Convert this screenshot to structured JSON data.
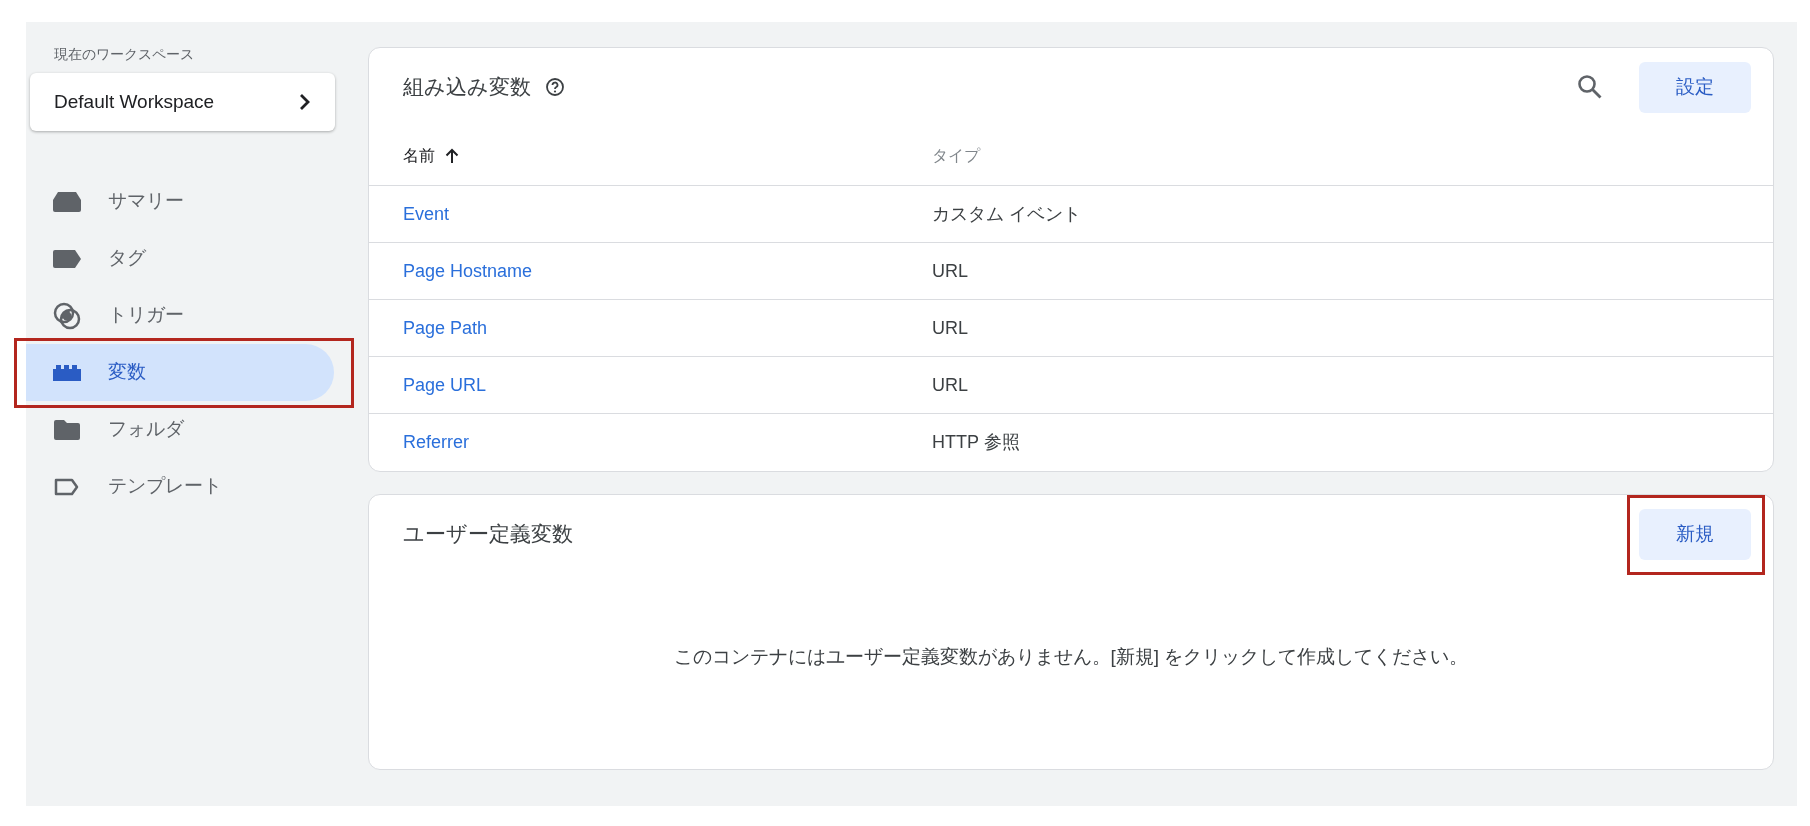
{
  "sidebar": {
    "workspace_label": "現在のワークスペース",
    "workspace": "Default Workspace",
    "items": [
      {
        "label": "サマリー",
        "selected": false
      },
      {
        "label": "タグ",
        "selected": false
      },
      {
        "label": "トリガー",
        "selected": false
      },
      {
        "label": "変数",
        "selected": true,
        "highlighted": true
      },
      {
        "label": "フォルダ",
        "selected": false
      },
      {
        "label": "テンプレート",
        "selected": false
      }
    ]
  },
  "builtin": {
    "title": "組み込み変数",
    "button": "設定",
    "columns": [
      {
        "label": "名前",
        "sorted": true
      },
      {
        "label": "タイプ",
        "sorted": false
      }
    ],
    "rows": [
      {
        "name": "Event",
        "type": "カスタム イベント"
      },
      {
        "name": "Page Hostname",
        "type": "URL"
      },
      {
        "name": "Page Path",
        "type": "URL"
      },
      {
        "name": "Page URL",
        "type": "URL"
      },
      {
        "name": "Referrer",
        "type": "HTTP 参照"
      }
    ]
  },
  "user_defined": {
    "title": "ユーザー定義変数",
    "button": "新規",
    "button_highlighted": true,
    "empty_message": "このコンテナにはユーザー定義変数がありません。[新規] をクリックして作成してください。"
  }
}
